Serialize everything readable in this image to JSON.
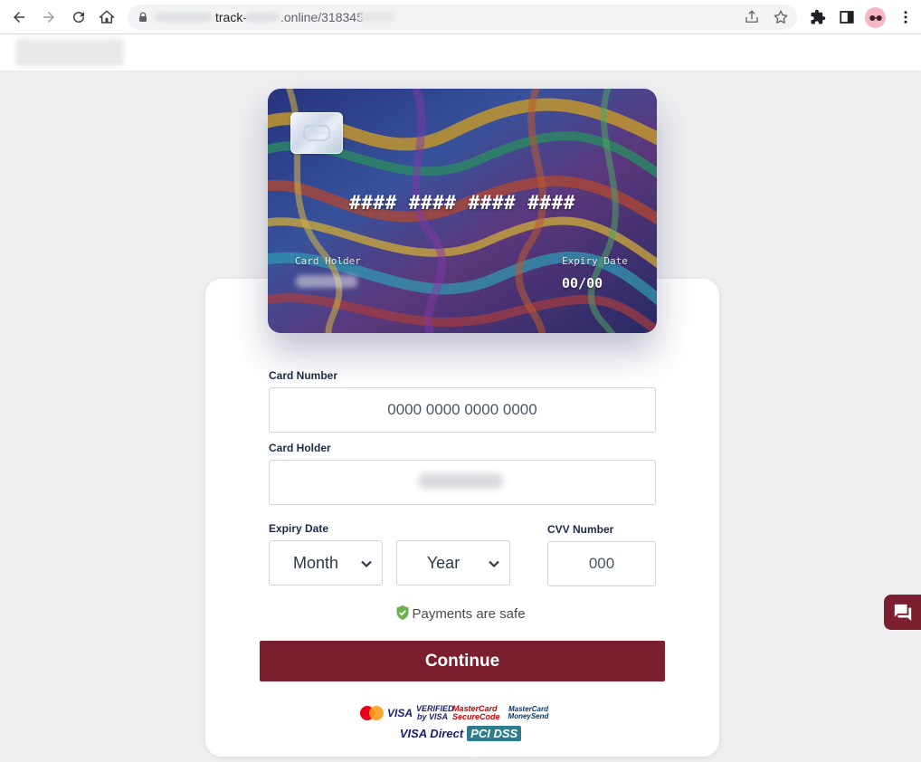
{
  "browser": {
    "url_prefix": "track-",
    "url_suffix": ".online/318345"
  },
  "card": {
    "number_mask": "#### #### #### ####",
    "holder_label": "Card Holder",
    "expiry_label": "Expiry Date",
    "expiry_value": "00/00"
  },
  "form": {
    "card_number_label": "Card Number",
    "card_number_placeholder": "0000 0000 0000 0000",
    "card_holder_label": "Card Holder",
    "expiry_label": "Expiry Date",
    "month_label": "Month",
    "year_label": "Year",
    "cvv_label": "CVV Number",
    "cvv_placeholder": "000",
    "safe_text": "Payments are safe",
    "continue_label": "Continue"
  },
  "logos": {
    "row1": [
      "MasterCard",
      "VISA",
      "VERIFIED by VISA",
      "MasterCard SecureCode",
      "MasterCard MoneySend"
    ],
    "row2": [
      "VISA Direct",
      "PCI DSS"
    ]
  },
  "colors": {
    "brand": "#7b1f2f",
    "label": "#1c2a4a",
    "page_bg": "#efeff1",
    "safe_shield": "#6ab04c"
  },
  "icons": {
    "back": "arrow-left-icon",
    "forward": "arrow-right-icon",
    "reload": "reload-icon",
    "home": "home-icon",
    "lock": "lock-icon",
    "share": "share-icon",
    "bookmark": "star-icon",
    "extensions": "puzzle-icon",
    "side_panel": "side-panel-icon",
    "menu": "kebab-menu-icon",
    "chat": "chat-icon",
    "shield": "shield-check-icon"
  }
}
